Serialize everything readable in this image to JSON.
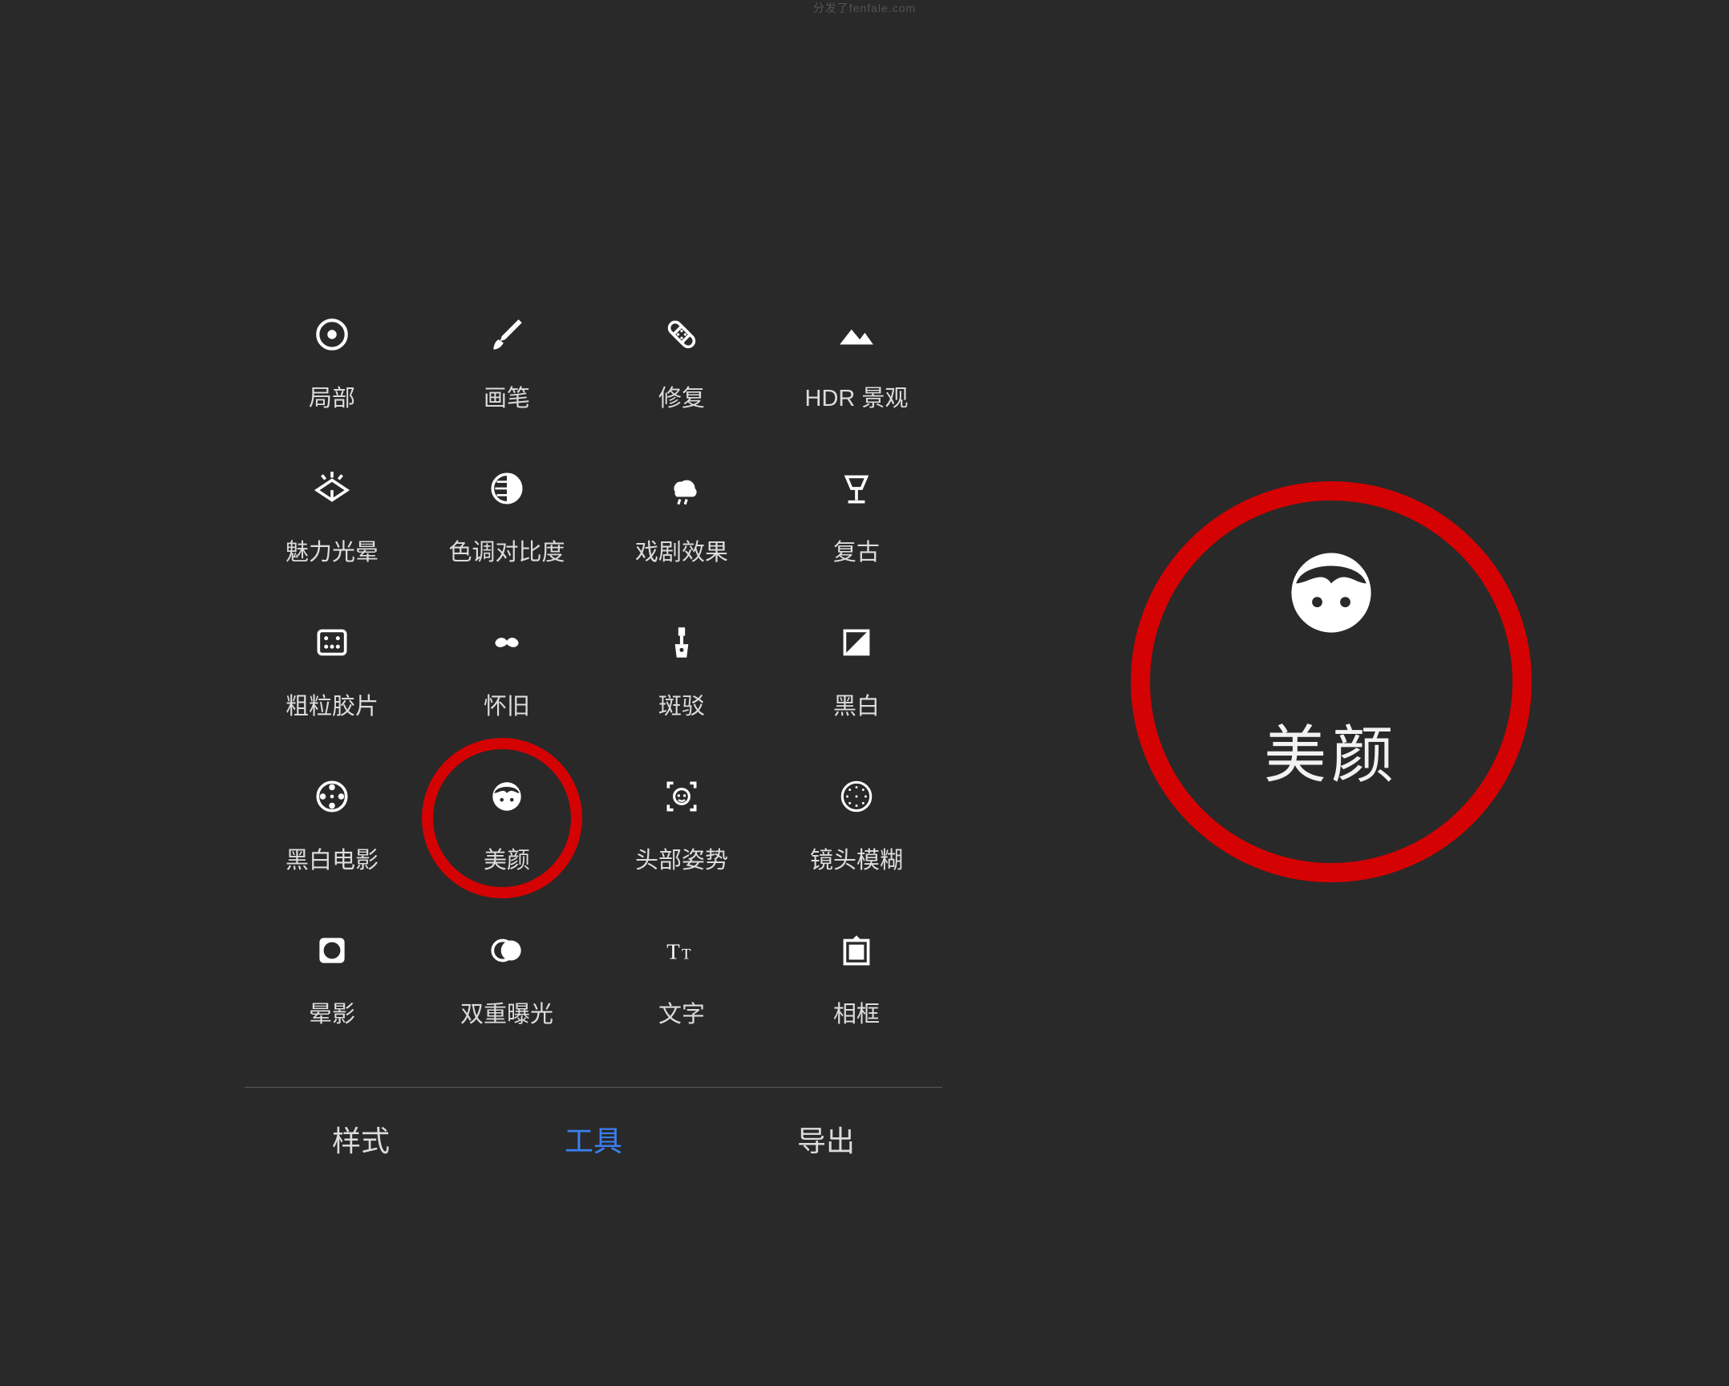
{
  "watermark": "分发了fenfale.com",
  "tools": {
    "row1": [
      {
        "id": "selective",
        "label": "局部"
      },
      {
        "id": "brush",
        "label": "画笔"
      },
      {
        "id": "healing",
        "label": "修复"
      },
      {
        "id": "hdr",
        "label": "HDR 景观"
      }
    ],
    "row2": [
      {
        "id": "glamour",
        "label": "魅力光晕"
      },
      {
        "id": "tonal",
        "label": "色调对比度"
      },
      {
        "id": "drama",
        "label": "戏剧效果"
      },
      {
        "id": "vintage",
        "label": "复古"
      }
    ],
    "row3": [
      {
        "id": "grainy",
        "label": "粗粒胶片"
      },
      {
        "id": "retrolux",
        "label": "怀旧"
      },
      {
        "id": "grunge",
        "label": "斑驳"
      },
      {
        "id": "bw",
        "label": "黑白"
      }
    ],
    "row4": [
      {
        "id": "noir",
        "label": "黑白电影"
      },
      {
        "id": "portrait",
        "label": "美颜"
      },
      {
        "id": "headpose",
        "label": "头部姿势"
      },
      {
        "id": "lensblur",
        "label": "镜头模糊"
      }
    ],
    "row5": [
      {
        "id": "vignette",
        "label": "晕影"
      },
      {
        "id": "doubleexp",
        "label": "双重曝光"
      },
      {
        "id": "text",
        "label": "文字"
      },
      {
        "id": "frames",
        "label": "相框"
      }
    ]
  },
  "tabs": {
    "styles": "样式",
    "tools": "工具",
    "export": "导出",
    "active": "tools"
  },
  "zoom": {
    "label": "美颜"
  },
  "colors": {
    "bg": "#292929",
    "text": "#dcdcdc",
    "accent": "#3a7ff0",
    "highlight": "#d40202"
  }
}
